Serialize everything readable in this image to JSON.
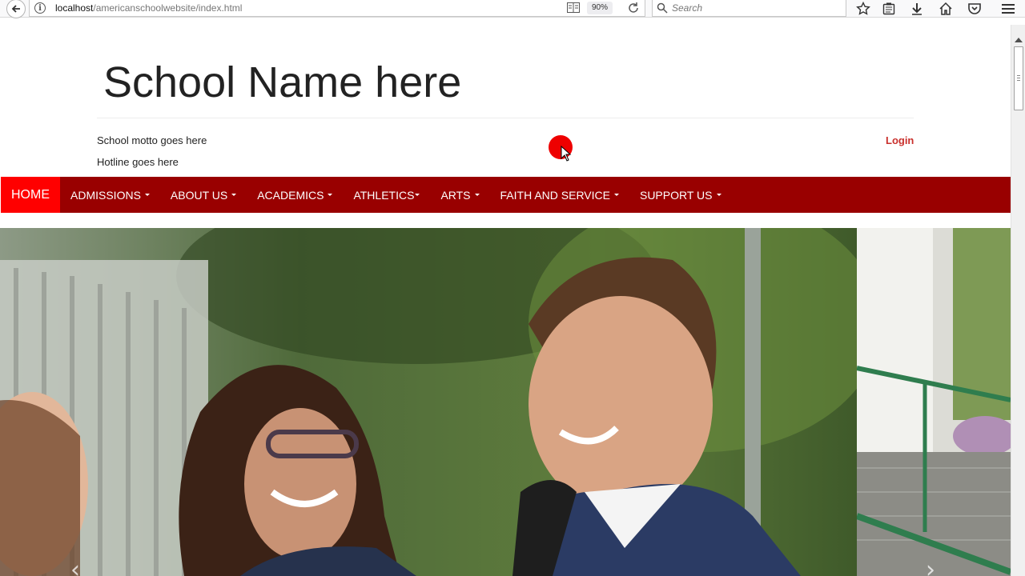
{
  "browser": {
    "url_host": "localhost",
    "url_path": "/americanschoolwebsite/index.html",
    "zoom": "90%",
    "search_placeholder": "Search"
  },
  "header": {
    "title": "School Name here",
    "motto": "School motto goes here",
    "hotline": "Hotline goes here",
    "login": "Login"
  },
  "nav": {
    "home": "HOME",
    "items": [
      "ADMISSIONS",
      "ABOUT US",
      "ACADEMICS",
      "ATHLETICS",
      "ARTS",
      "FAITH AND SERVICE",
      "SUPPORT US"
    ]
  },
  "carousel": {
    "prev_glyph": "‹",
    "next_glyph": "›"
  },
  "colors": {
    "nav_bg": "#990000",
    "nav_active": "#ff0000",
    "login": "#c9302c"
  }
}
